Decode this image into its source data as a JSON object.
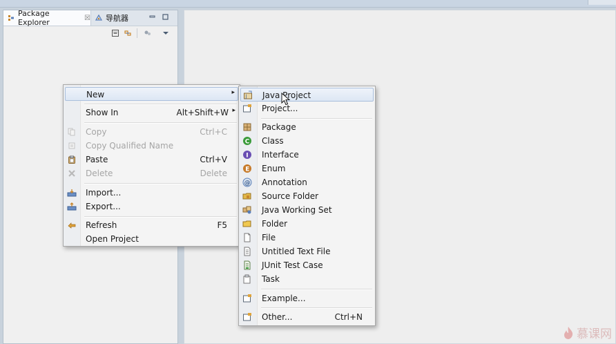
{
  "app": {
    "view_tabs": [
      {
        "label": "Package Explorer",
        "icon": "package-explorer-icon",
        "active": true,
        "close_glyph": "☒"
      },
      {
        "label": "导航器",
        "icon": "navigator-icon",
        "active": false
      }
    ],
    "view_window_buttons": [
      "minimize",
      "maximize"
    ],
    "view_toolbar": [
      "collapse-all",
      "link-with-editor",
      "focus",
      "view-menu"
    ]
  },
  "context_menu": {
    "items": [
      {
        "label": "New",
        "submenu": true,
        "arrow": "▸",
        "highlighted": true
      },
      {
        "label": "Show In",
        "accelerator": "Alt+Shift+W",
        "submenu": true,
        "arrow": "▸"
      },
      {
        "label": "Copy",
        "accelerator": "Ctrl+C",
        "disabled": true,
        "icon": "copy-icon"
      },
      {
        "label": "Copy Qualified Name",
        "disabled": true,
        "icon": "copy-qualified-name-icon"
      },
      {
        "label": "Paste",
        "accelerator": "Ctrl+V",
        "icon": "paste-icon"
      },
      {
        "label": "Delete",
        "accelerator": "Delete",
        "disabled": true,
        "icon": "delete-icon"
      },
      {
        "label": "Import...",
        "icon": "import-icon"
      },
      {
        "label": "Export...",
        "icon": "export-icon"
      },
      {
        "label": "Refresh",
        "accelerator": "F5",
        "icon": "refresh-icon"
      },
      {
        "label": "Open Project"
      }
    ]
  },
  "new_submenu": {
    "items": [
      {
        "label": "Java Project",
        "icon": "java-project-icon",
        "highlighted": true
      },
      {
        "label": "Project...",
        "icon": "project-icon"
      },
      {
        "label": "Package",
        "icon": "package-icon"
      },
      {
        "label": "Class",
        "icon": "class-icon"
      },
      {
        "label": "Interface",
        "icon": "interface-icon"
      },
      {
        "label": "Enum",
        "icon": "enum-icon"
      },
      {
        "label": "Annotation",
        "icon": "annotation-icon"
      },
      {
        "label": "Source Folder",
        "icon": "source-folder-icon"
      },
      {
        "label": "Java Working Set",
        "icon": "java-working-set-icon"
      },
      {
        "label": "Folder",
        "icon": "folder-icon"
      },
      {
        "label": "File",
        "icon": "file-icon"
      },
      {
        "label": "Untitled Text File",
        "icon": "untitled-text-file-icon"
      },
      {
        "label": "JUnit Test Case",
        "icon": "junit-test-case-icon"
      },
      {
        "label": "Task",
        "icon": "task-icon"
      },
      {
        "label": "Example...",
        "icon": "example-icon"
      },
      {
        "label": "Other...",
        "accelerator": "Ctrl+N",
        "icon": "other-wizard-icon"
      }
    ]
  },
  "watermark": {
    "text": "慕课网",
    "icon": "flame-logo-icon"
  },
  "colors": {
    "class_icon": "#3a9b3a",
    "interface_icon": "#6a4fb3",
    "enum_icon": "#c77b2a",
    "package_icon": "#b0874a",
    "folder_icon": "#e2b84a",
    "highlight_border": "#a9bfdc"
  }
}
